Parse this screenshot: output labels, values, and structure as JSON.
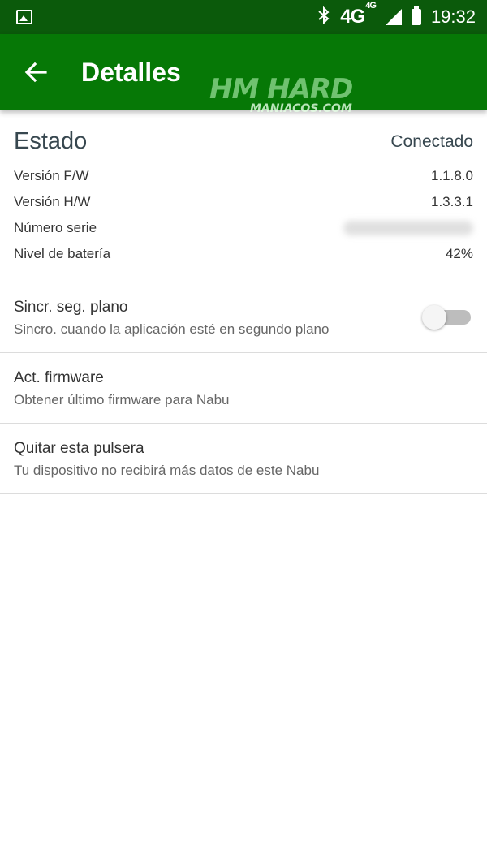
{
  "status_bar": {
    "network": "4G",
    "network_small": "4G",
    "time": "19:32",
    "icons": [
      "gallery-icon",
      "bluetooth-icon",
      "signal-icon",
      "battery-icon"
    ]
  },
  "app_bar": {
    "title": "Detalles",
    "back_icon": "arrow-left-icon",
    "background": "#067806"
  },
  "watermark": {
    "line1": "HM HARD",
    "line2": "MANIACOS.COM"
  },
  "status": {
    "label": "Estado",
    "value": "Conectado",
    "rows": [
      {
        "label": "Versión F/W",
        "value": "1.1.8.0"
      },
      {
        "label": "Versión H/W",
        "value": "1.3.3.1"
      },
      {
        "label": "Número serie",
        "value": ""
      },
      {
        "label": "Nivel de batería",
        "value": "42%"
      }
    ]
  },
  "settings": {
    "background_sync": {
      "title": "Sincr. seg. plano",
      "subtitle": "Sincro. cuando la aplicación esté en segundo plano",
      "enabled": false
    },
    "firmware": {
      "title": "Act. firmware",
      "subtitle": "Obtener último firmware para Nabu"
    },
    "remove": {
      "title": "Quitar esta pulsera",
      "subtitle": "Tu dispositivo no recibirá más datos de este Nabu"
    }
  }
}
